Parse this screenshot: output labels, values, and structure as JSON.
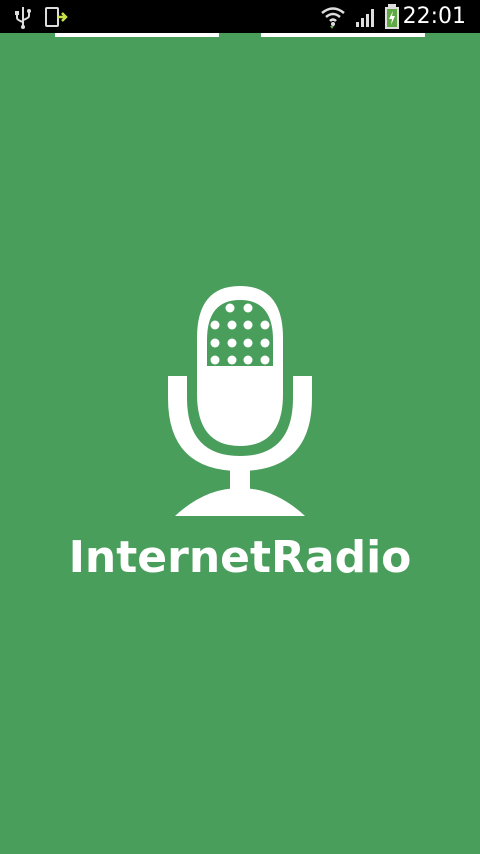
{
  "status_bar": {
    "time": "22:01",
    "icons": [
      "usb-icon",
      "download-icon",
      "wifi-icon",
      "signal-icon",
      "battery-charging-icon"
    ]
  },
  "splash": {
    "logo_icon": "microphone-icon",
    "app_name": "InternetRadio",
    "background_color": "#4a9e5c",
    "foreground_color": "#ffffff"
  }
}
